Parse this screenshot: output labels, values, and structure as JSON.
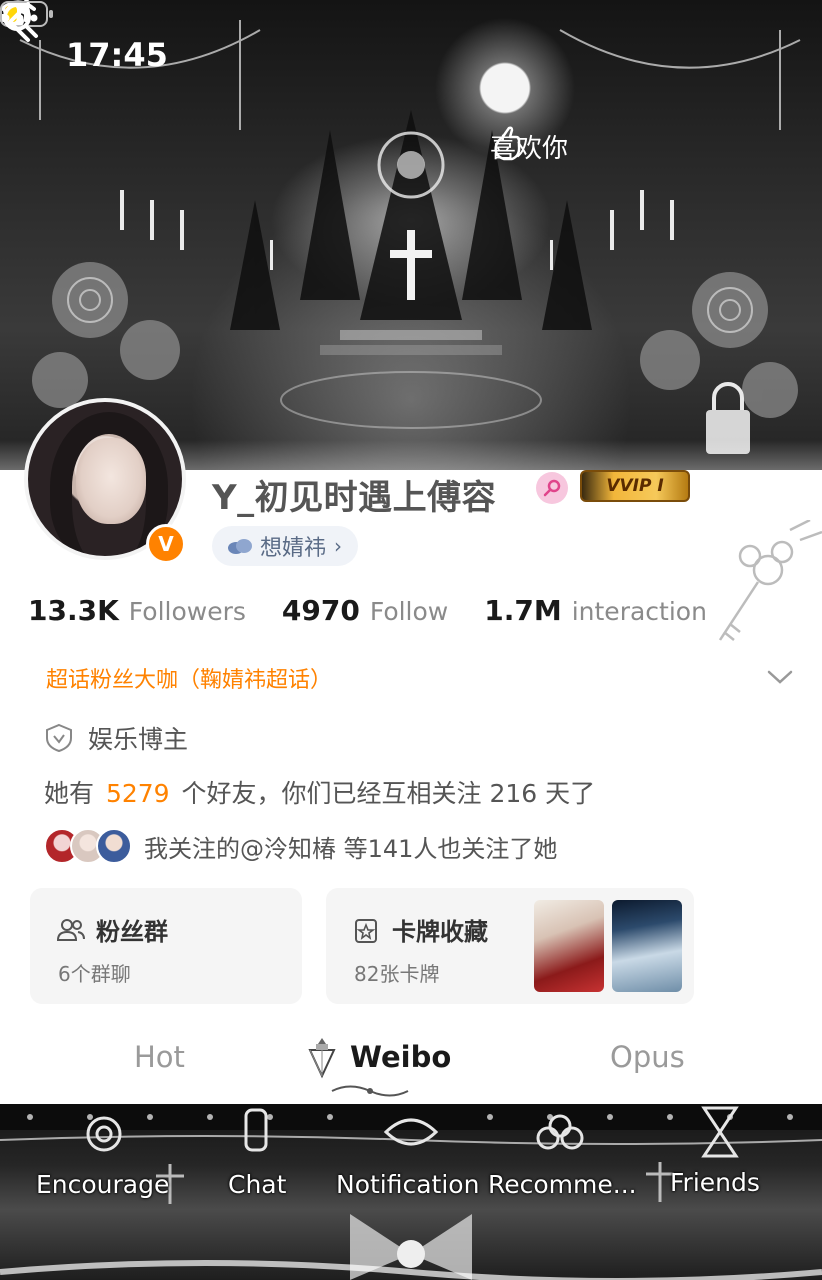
{
  "status_bar": {
    "time": "17:45"
  },
  "top_nav": {
    "like_label": "喜欢你"
  },
  "profile": {
    "username": "Y_初见时遇上傅容",
    "verified_mark": "V",
    "vip_label": "VVIP I",
    "supertopic_label": "想婧祎",
    "supertopic_arrow": "›"
  },
  "stats": [
    {
      "number": "13.3K",
      "label": "Followers"
    },
    {
      "number": "4970",
      "label": "Follow"
    },
    {
      "number": "1.7M",
      "label": "interaction"
    }
  ],
  "fan_title": "超话粉丝大咖（鞠婧祎超话）",
  "certification": "娱乐博主",
  "friends": {
    "prefix": "她有",
    "count": "5279",
    "suffix": "个好友，你们已经互相关注 216 天了"
  },
  "mutual": {
    "text": "我关注的@泠知椿 等141人也关注了她"
  },
  "cards": {
    "fans": {
      "title": "粉丝群",
      "sub": "6个群聊"
    },
    "collection": {
      "title": "卡牌收藏",
      "sub": "82张卡牌"
    }
  },
  "tabs": [
    {
      "label": "Hot",
      "active": false
    },
    {
      "label": "Weibo",
      "active": true
    },
    {
      "label": "Opus",
      "active": false
    }
  ],
  "bottom_nav": [
    {
      "label": "Encourage"
    },
    {
      "label": "Chat"
    },
    {
      "label": "Notification"
    },
    {
      "label": "Recomme..."
    },
    {
      "label": "Friends"
    }
  ],
  "colors": {
    "accent": "#ff8200",
    "chip_text": "#5a6b86",
    "text_muted": "#8a8a8a"
  },
  "icons": [
    "paw-icon",
    "signal-icon",
    "wifi-icon",
    "battery-icon",
    "back-icon",
    "like-hand-icon",
    "search-icon",
    "more-icon",
    "verified-icon",
    "female-icon",
    "vip-crown-icon",
    "cloud-icon",
    "chevron-down-icon",
    "shield-check-icon",
    "people-icon",
    "card-star-icon",
    "gem-icon"
  ]
}
